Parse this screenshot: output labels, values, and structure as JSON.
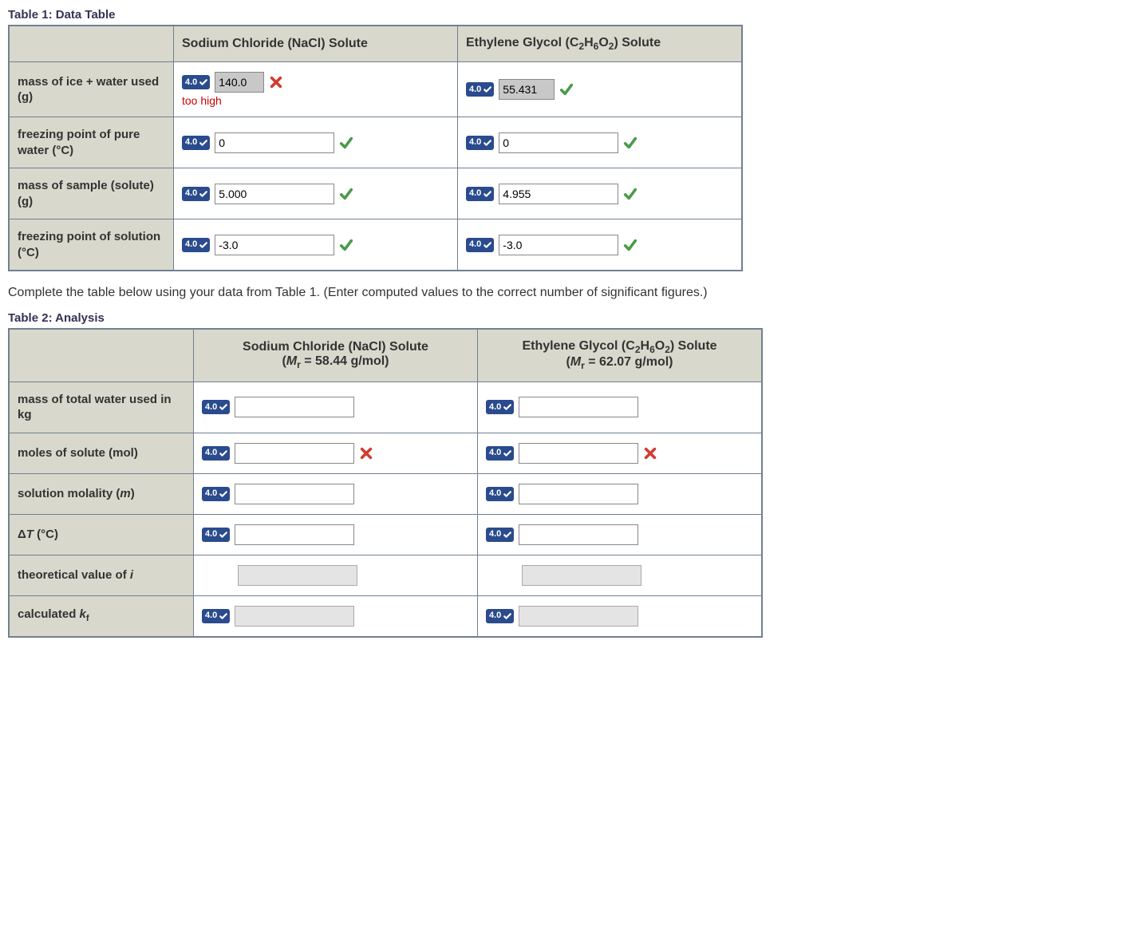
{
  "table1": {
    "title": "Table 1: Data Table",
    "col1_header": "Sodium Chloride (NaCl) Solute",
    "col2_prefix": "Ethylene Glycol (C",
    "col2_sub1": "2",
    "col2_mid1": "H",
    "col2_sub2": "6",
    "col2_mid2": "O",
    "col2_sub3": "2",
    "col2_suffix": ") Solute",
    "rows": {
      "r1": {
        "label": "mass of ice + water used (g)",
        "c1_value": "140.0",
        "c1_feedback": "too high",
        "c2_value": "55.431"
      },
      "r2": {
        "label": "freezing point of pure water (°C)",
        "c1_value": "0",
        "c2_value": "0"
      },
      "r3": {
        "label": "mass of sample (solute) (g)",
        "c1_value": "5.000",
        "c2_value": "4.955"
      },
      "r4": {
        "label": "freezing point of solution (°C)",
        "c1_value": "-3.0",
        "c2_value": "-3.0"
      }
    }
  },
  "instruction": "Complete the table below using your data from Table 1. (Enter computed values to the correct number of significant figures.)",
  "table2": {
    "title": "Table 2: Analysis",
    "col1_line1": "Sodium Chloride (NaCl) Solute",
    "col1_line2_prefix": "(",
    "col1_M": "M",
    "col1_rsub": "r",
    "col1_line2_suffix": " = 58.44 g/mol)",
    "col2_prefix": "Ethylene Glycol (C",
    "col2_sub1": "2",
    "col2_mid1": "H",
    "col2_sub2": "6",
    "col2_mid2": "O",
    "col2_sub3": "2",
    "col2_suffix": ") Solute",
    "col2_line2_prefix": "(",
    "col2_M": "M",
    "col2_rsub": "r",
    "col2_line2_suffix": " = 62.07 g/mol)",
    "rows": {
      "r1": {
        "label": "mass of total water used in kg"
      },
      "r2": {
        "label": "moles of solute (mol)"
      },
      "r3": {
        "label_prefix": "solution molality (",
        "label_m": "m",
        "label_suffix": ")"
      },
      "r4": {
        "label_prefix": "Δ",
        "label_T": "T",
        "label_suffix": " (°C)"
      },
      "r5": {
        "label_prefix": "theoretical value of ",
        "label_i": "i"
      },
      "r6": {
        "label_prefix": "calculated ",
        "label_k": "k",
        "label_fsub": "f"
      }
    }
  },
  "badge_label": "4.0"
}
